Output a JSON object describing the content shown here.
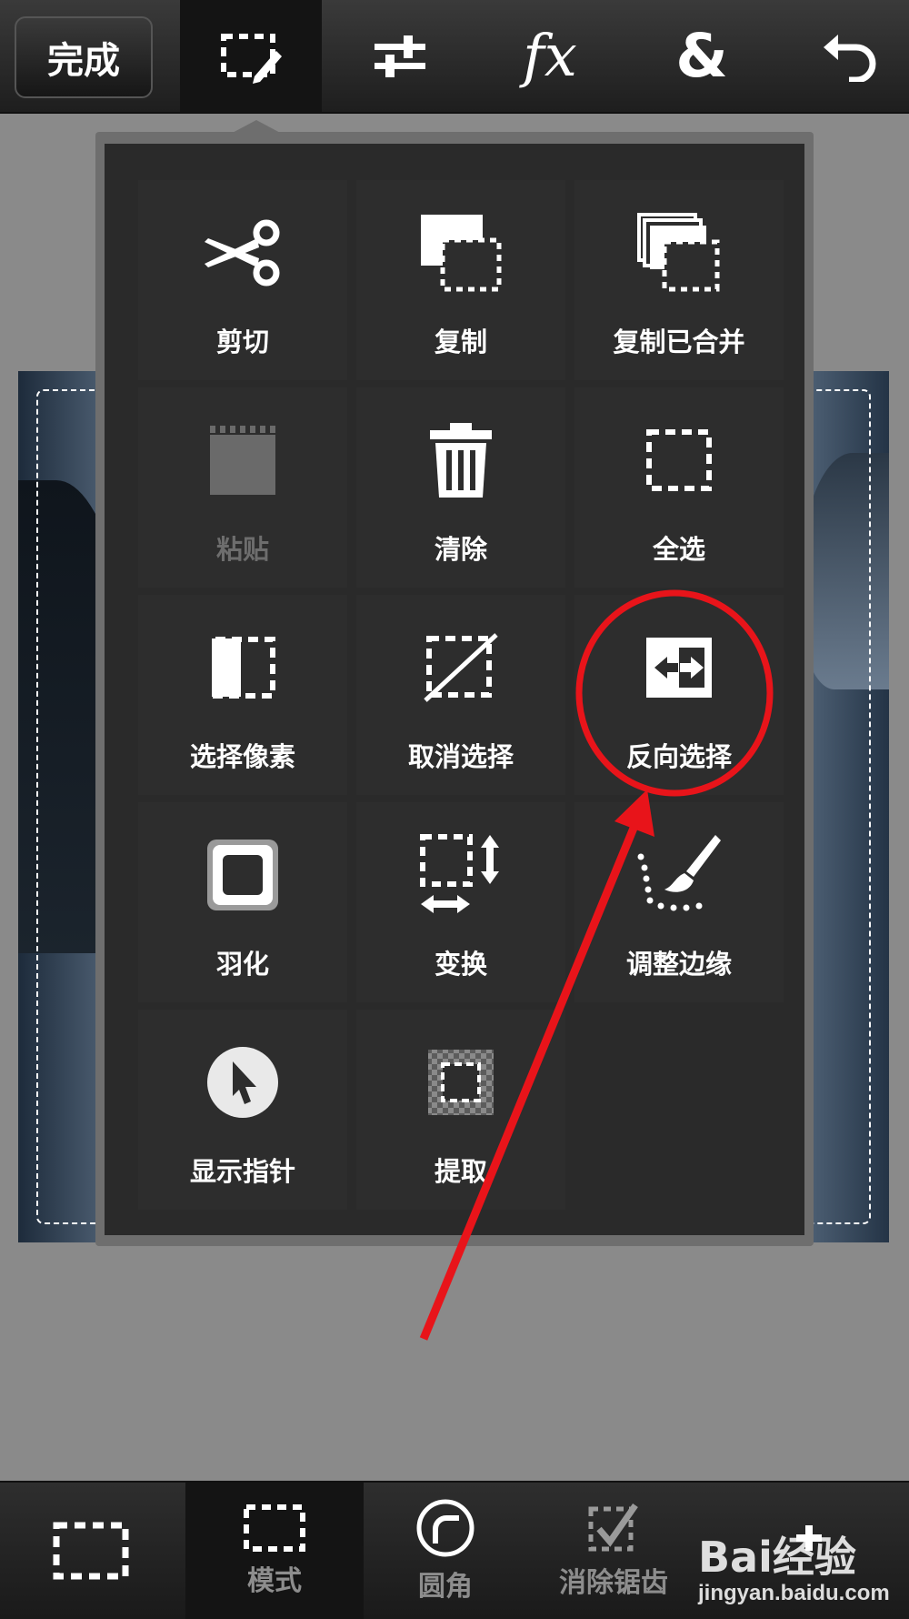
{
  "toolbar": {
    "done_label": "完成",
    "icons": [
      "selection-edit-icon",
      "adjust-sliders-icon",
      "fx-icon",
      "ampersand-icon",
      "undo-icon"
    ],
    "fx_text": "fx",
    "amp_text": "&"
  },
  "menu": {
    "items": [
      {
        "label": "剪切",
        "icon": "scissors-icon",
        "enabled": true
      },
      {
        "label": "复制",
        "icon": "copy-icon",
        "enabled": true
      },
      {
        "label": "复制已合并",
        "icon": "copy-merged-icon",
        "enabled": true
      },
      {
        "label": "粘贴",
        "icon": "paste-icon",
        "enabled": false
      },
      {
        "label": "清除",
        "icon": "trash-icon",
        "enabled": true
      },
      {
        "label": "全选",
        "icon": "select-all-icon",
        "enabled": true
      },
      {
        "label": "选择像素",
        "icon": "select-pixels-icon",
        "enabled": true
      },
      {
        "label": "取消选择",
        "icon": "deselect-icon",
        "enabled": true
      },
      {
        "label": "反向选择",
        "icon": "invert-selection-icon",
        "enabled": true
      },
      {
        "label": "羽化",
        "icon": "feather-icon",
        "enabled": true
      },
      {
        "label": "变换",
        "icon": "transform-icon",
        "enabled": true
      },
      {
        "label": "调整边缘",
        "icon": "refine-edge-icon",
        "enabled": true
      },
      {
        "label": "显示指针",
        "icon": "show-pointer-icon",
        "enabled": true
      },
      {
        "label": "提取",
        "icon": "extract-icon",
        "enabled": true
      }
    ]
  },
  "bottom": {
    "items": [
      {
        "label": "",
        "icon": "rect-selection-icon"
      },
      {
        "label": "模式",
        "icon": "mode-icon"
      },
      {
        "label": "圆角",
        "icon": "rounded-corner-icon"
      },
      {
        "label": "消除锯齿",
        "icon": "anti-alias-icon"
      }
    ]
  },
  "watermark": {
    "main": "Bai经验",
    "sub": "jingyan.baidu.com"
  },
  "colors": {
    "annotation": "#e8141a",
    "panel": "#2a2a2a",
    "canvas": "#8a8a8a"
  }
}
